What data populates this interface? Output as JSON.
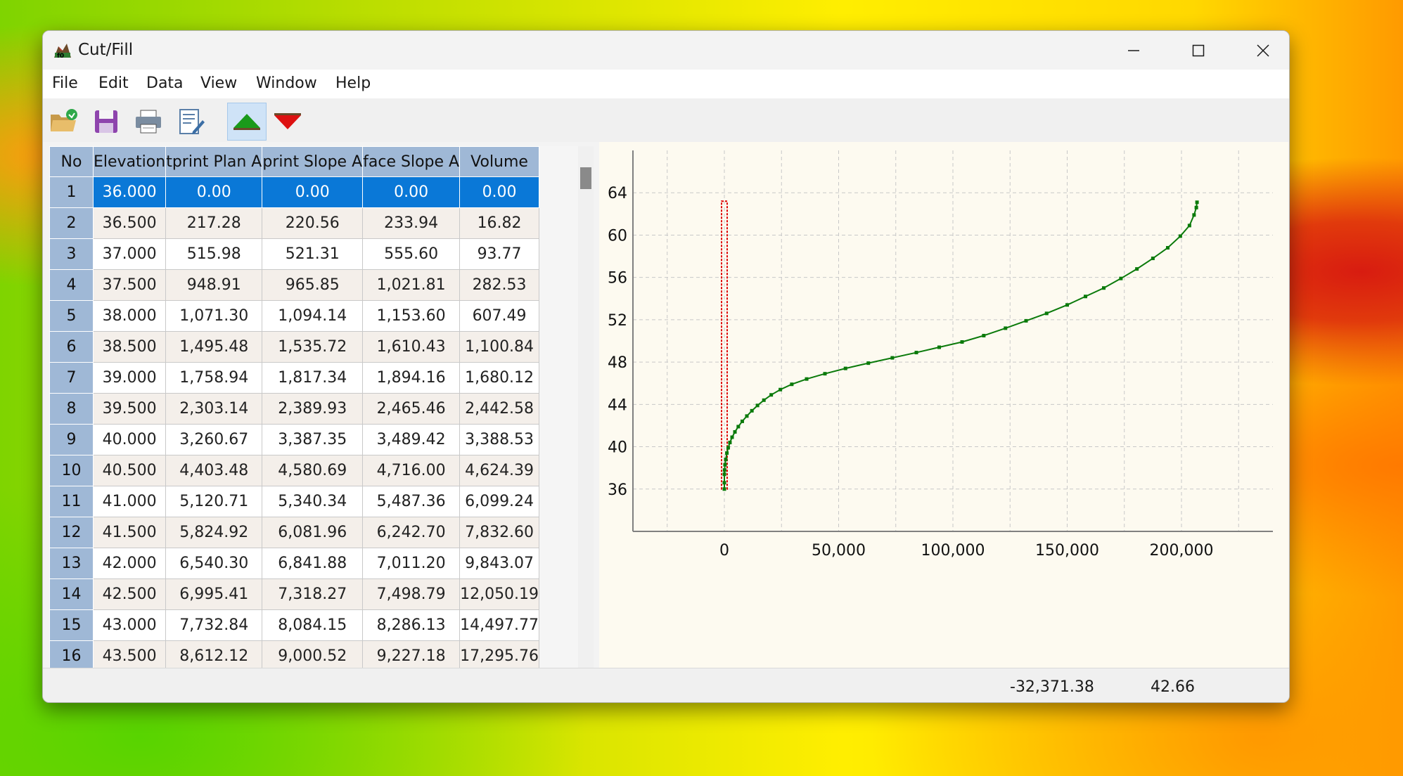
{
  "window": {
    "title": "Cut/Fill"
  },
  "menu": [
    "File",
    "Edit",
    "Data",
    "View",
    "Window",
    "Help"
  ],
  "toolbar": [
    {
      "name": "open-icon"
    },
    {
      "name": "save-icon"
    },
    {
      "name": "print-icon"
    },
    {
      "name": "edit-icon"
    },
    {
      "name": "fill-up-icon",
      "active": true
    },
    {
      "name": "cut-down-icon"
    }
  ],
  "table": {
    "columns": [
      "No",
      "Elevation",
      "Footprint Plan Area",
      "Footprint Slope Area",
      "Surface Slope Area",
      "Volume"
    ],
    "column_display": [
      "No",
      "Elevation",
      "tprint Plan A",
      "print Slope A",
      "face Slope A",
      "Volume"
    ],
    "selected_row": 1,
    "rows": [
      [
        "1",
        "36.000",
        "0.00",
        "0.00",
        "0.00",
        "0.00"
      ],
      [
        "2",
        "36.500",
        "217.28",
        "220.56",
        "233.94",
        "16.82"
      ],
      [
        "3",
        "37.000",
        "515.98",
        "521.31",
        "555.60",
        "93.77"
      ],
      [
        "4",
        "37.500",
        "948.91",
        "965.85",
        "1,021.81",
        "282.53"
      ],
      [
        "5",
        "38.000",
        "1,071.30",
        "1,094.14",
        "1,153.60",
        "607.49"
      ],
      [
        "6",
        "38.500",
        "1,495.48",
        "1,535.72",
        "1,610.43",
        "1,100.84"
      ],
      [
        "7",
        "39.000",
        "1,758.94",
        "1,817.34",
        "1,894.16",
        "1,680.12"
      ],
      [
        "8",
        "39.500",
        "2,303.14",
        "2,389.93",
        "2,465.46",
        "2,442.58"
      ],
      [
        "9",
        "40.000",
        "3,260.67",
        "3,387.35",
        "3,489.42",
        "3,388.53"
      ],
      [
        "10",
        "40.500",
        "4,403.48",
        "4,580.69",
        "4,716.00",
        "4,624.39"
      ],
      [
        "11",
        "41.000",
        "5,120.71",
        "5,340.34",
        "5,487.36",
        "6,099.24"
      ],
      [
        "12",
        "41.500",
        "5,824.92",
        "6,081.96",
        "6,242.70",
        "7,832.60"
      ],
      [
        "13",
        "42.000",
        "6,540.30",
        "6,841.88",
        "7,011.20",
        "9,843.07"
      ],
      [
        "14",
        "42.500",
        "6,995.41",
        "7,318.27",
        "7,498.79",
        "12,050.19"
      ],
      [
        "15",
        "43.000",
        "7,732.84",
        "8,084.15",
        "8,286.13",
        "14,497.77"
      ],
      [
        "16",
        "43.500",
        "8,612.12",
        "9,000.52",
        "9,227.18",
        "17,295.76"
      ]
    ]
  },
  "chart_data": {
    "type": "line",
    "xlim": [
      -40000,
      240000
    ],
    "ylim": [
      32,
      68
    ],
    "x_ticks": [
      0,
      50000,
      100000,
      150000,
      200000
    ],
    "x_tick_labels": [
      "0",
      "50,000",
      "100,000",
      "150,000",
      "200,000"
    ],
    "y_ticks": [
      36,
      40,
      44,
      48,
      52,
      56,
      60,
      64
    ],
    "y_tick_labels": [
      "36",
      "40",
      "44",
      "48",
      "52",
      "56",
      "60",
      "64"
    ],
    "grid": true,
    "series": [
      {
        "color": "#dd0000",
        "x": [
          0,
          0
        ],
        "y": [
          36,
          63.2
        ]
      },
      {
        "color": "#0a7a0a",
        "x": [
          0,
          0.1,
          17,
          94,
          283,
          607,
          1101,
          1680,
          2443,
          3389,
          4624,
          6099,
          7833,
          9843,
          12050,
          14498,
          17296,
          20500,
          24500,
          29500,
          36000,
          44000,
          53000,
          63000,
          73500,
          84000,
          94000,
          104000,
          113500,
          123000,
          132000,
          141000,
          150000,
          158000,
          166000,
          173500,
          180500,
          187500,
          194000,
          199500,
          203500,
          205500,
          206500,
          206800
        ],
        "y": [
          36,
          36.6,
          37.4,
          37.8,
          38.3,
          38.8,
          39.4,
          39.9,
          40.4,
          40.9,
          41.4,
          41.9,
          42.4,
          42.9,
          43.4,
          43.9,
          44.4,
          44.9,
          45.4,
          45.9,
          46.4,
          46.9,
          47.4,
          47.9,
          48.4,
          48.9,
          49.4,
          49.9,
          50.5,
          51.2,
          51.9,
          52.6,
          53.4,
          54.2,
          55.0,
          55.9,
          56.8,
          57.8,
          58.8,
          59.9,
          60.9,
          61.9,
          62.6,
          63.1
        ]
      }
    ]
  },
  "status": {
    "x_value": "-32,371.38",
    "y_value": "42.66"
  }
}
